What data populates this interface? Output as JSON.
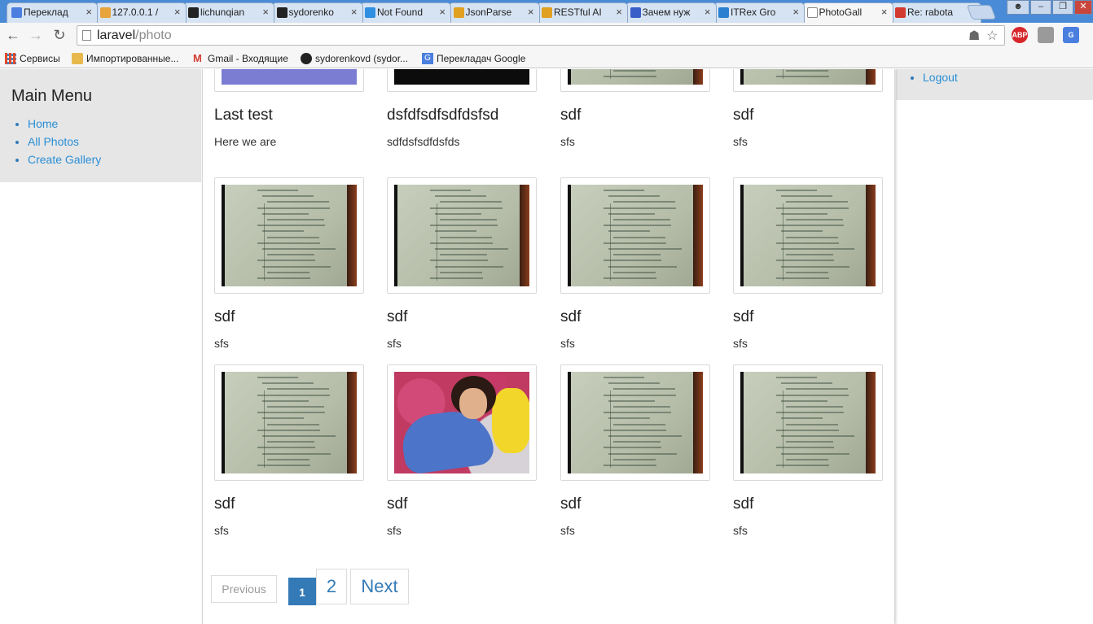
{
  "browser": {
    "tabs": [
      {
        "label": "Переклад",
        "icon": "google-translate-icon",
        "color": "#4a7fe0"
      },
      {
        "label": "127.0.0.1 /",
        "icon": "phpmyadmin-icon",
        "color": "#e8a33c"
      },
      {
        "label": "lichunqian",
        "icon": "github-icon",
        "color": "#222222"
      },
      {
        "label": "sydorenko",
        "icon": "github-icon",
        "color": "#222222"
      },
      {
        "label": "Not Found",
        "icon": "windows-icon",
        "color": "#2f8fe0"
      },
      {
        "label": "JsonParse",
        "icon": "pinwheel-icon",
        "color": "#e0a020"
      },
      {
        "label": "RESTful AI",
        "icon": "pinwheel-icon",
        "color": "#e0a020"
      },
      {
        "label": "Зачем нуж",
        "icon": "dots-icon",
        "color": "#3a5ec8"
      },
      {
        "label": "ITRex Gro",
        "icon": "bird-icon",
        "color": "#2a7fd0"
      },
      {
        "label": "PhotoGall",
        "icon": "page-icon",
        "color": "#ffffff"
      },
      {
        "label": "Re: rabota",
        "icon": "gmail-icon",
        "color": "#d33a2f"
      }
    ],
    "tab_close": "×",
    "url_host": "laravel",
    "url_path": "/photo",
    "bookmarks": [
      "Сервисы",
      "Импортированные...",
      "Gmail - Входящие",
      "sydorenkovd (sydor...",
      "Перекладач Google"
    ],
    "ext_abp": "ABP"
  },
  "sidebar": {
    "title": "Main Menu",
    "items": [
      "Home",
      "All Photos",
      "Create Gallery"
    ]
  },
  "rightbar": {
    "items": [
      "Logout"
    ]
  },
  "photos": [
    {
      "title": "Last test",
      "desc": "Here we are",
      "img": "cutoff-girl"
    },
    {
      "title": "dsfdfsdfsdfdsfsd",
      "desc": "sdfdsfsdfdsfds",
      "img": "dark-face"
    },
    {
      "title": "sdf",
      "desc": "sfs",
      "img": "paper"
    },
    {
      "title": "sdf",
      "desc": "sfs",
      "img": "paper"
    },
    {
      "title": "sdf",
      "desc": "sfs",
      "img": "paper"
    },
    {
      "title": "sdf",
      "desc": "sfs",
      "img": "paper"
    },
    {
      "title": "sdf",
      "desc": "sfs",
      "img": "paper"
    },
    {
      "title": "sdf",
      "desc": "sfs",
      "img": "paper"
    },
    {
      "title": "sdf",
      "desc": "sfs",
      "img": "paper"
    },
    {
      "title": "sdf",
      "desc": "sfs",
      "img": "girl"
    },
    {
      "title": "sdf",
      "desc": "sfs",
      "img": "paper"
    },
    {
      "title": "sdf",
      "desc": "sfs",
      "img": "paper"
    }
  ],
  "pagination": {
    "previous": "Previous",
    "pages": [
      "1",
      "2"
    ],
    "current": "1",
    "next": "Next"
  },
  "colors": {
    "link": "#2a8fd6",
    "active_page": "#337ab7",
    "sidebar_bg": "#e6e6e6"
  }
}
